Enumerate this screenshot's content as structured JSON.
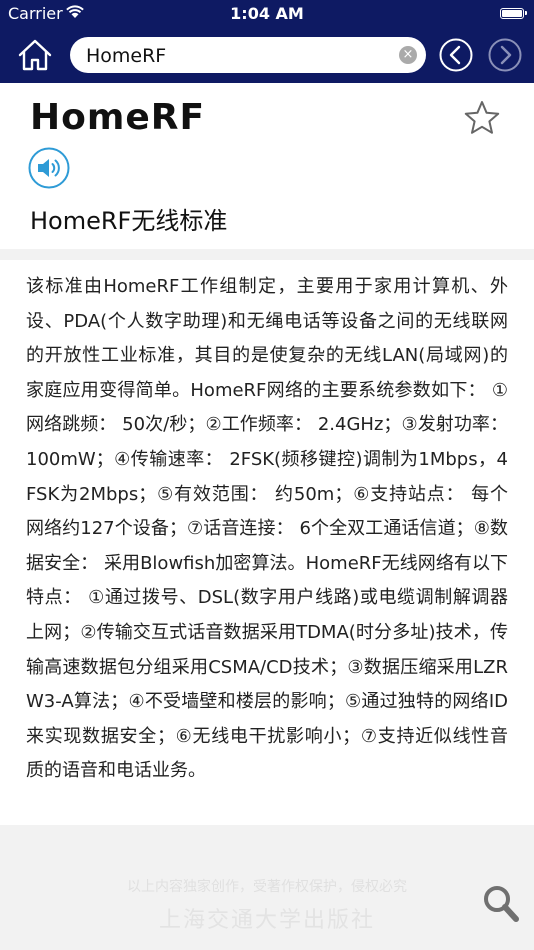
{
  "status_bar": {
    "carrier": "Carrier",
    "time": "1:04 AM"
  },
  "nav": {
    "search_value": "HomeRF",
    "icons": {
      "home": "home-icon",
      "clear": "clear-icon",
      "back": "chevron-left-icon",
      "forward": "chevron-right-icon"
    },
    "colors": {
      "bar": "#0e1a63"
    }
  },
  "entry": {
    "headword": "HomeRF",
    "subtitle": "HomeRF无线标准",
    "body": "该标准由HomeRF工作组制定，主要用于家用计算机、外设、PDA(个人数字助理)和无绳电话等设备之间的无线联网的开放性工业标准，其目的是使复杂的无线LAN(局域网)的家庭应用变得简单。HomeRF网络的主要系统参数如下： ①网络跳频： 50次/秒；②工作频率： 2.4GHz；③发射功率： 100mW；④传输速率： 2FSK(频移键控)调制为1Mbps，4FSK为2Mbps；⑤有效范围： 约50m；⑥支持站点： 每个网络约127个设备；⑦话音连接： 6个全双工通话信道；⑧数据安全： 采用Blowfish加密算法。HomeRF无线网络有以下特点： ①通过拨号、DSL(数字用户线路)或电缆调制解调器上网；②传输交互式话音数据采用TDMA(时分多址)技术，传输高速数据包分组采用CSMA/CD技术；③数据压缩采用LZRW3-A算法；④不受墙壁和楼层的影响；⑤通过独特的网络ID来实现数据安全；⑥无线电干扰影响小；⑦支持近似线性音质的语音和电话业务。",
    "icons": {
      "favorite": "star-icon",
      "audio": "speaker-icon"
    }
  },
  "footer": {
    "copyright": "以上内容独家创作，受著作权保护，侵权必究",
    "publisher": "上海交通大学出版社",
    "search_icon": "search-icon"
  }
}
